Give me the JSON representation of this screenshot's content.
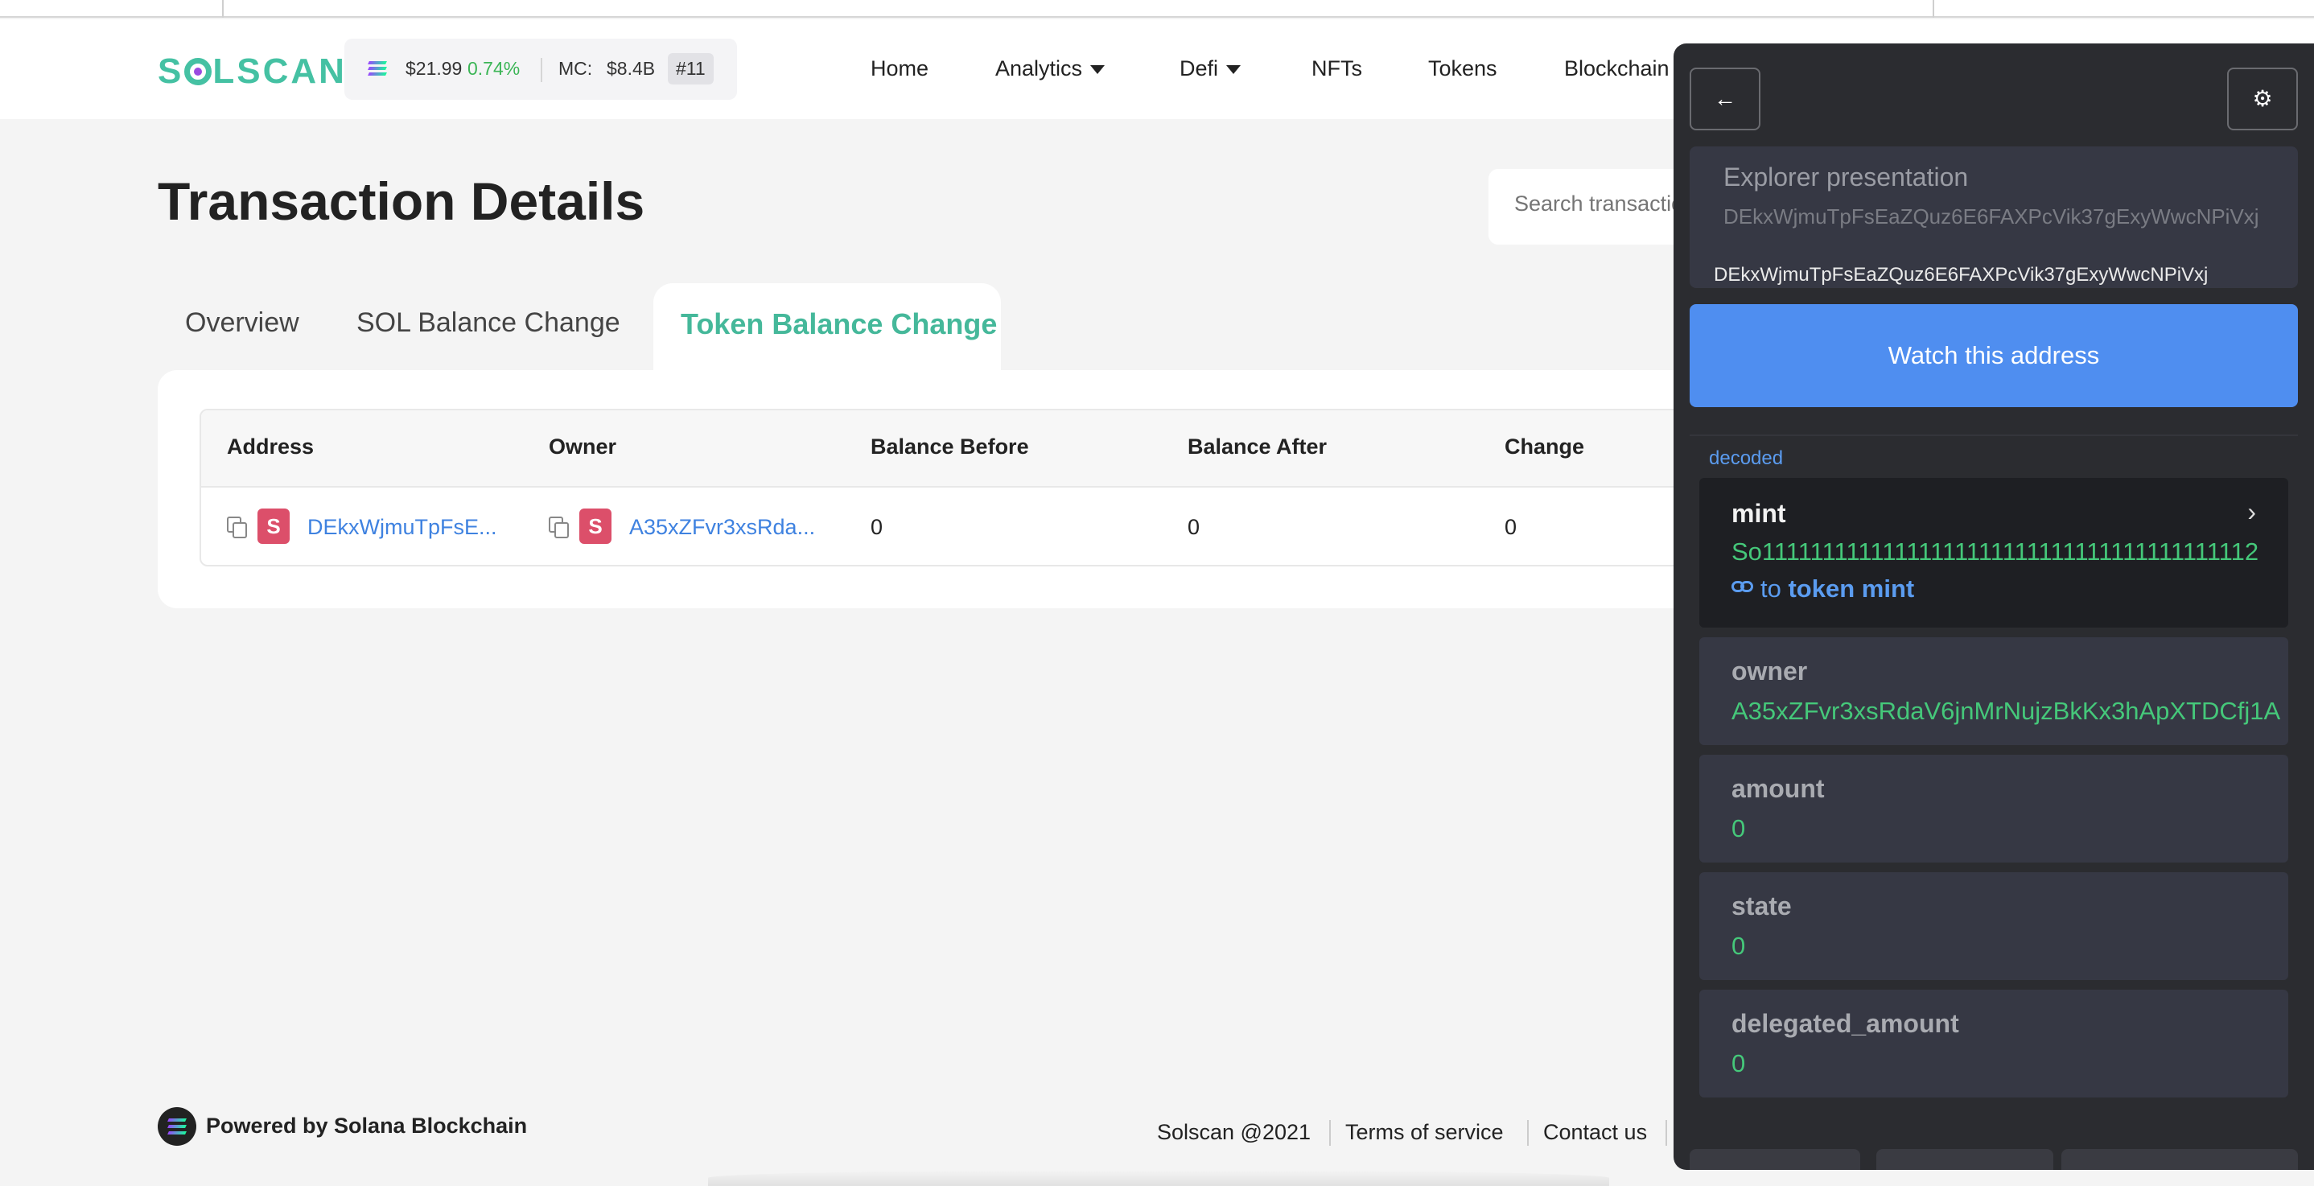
{
  "header": {
    "logo": "SOLSCAN",
    "sol_price": "$21.99",
    "sol_change": "0.74%",
    "mc_label": "MC:",
    "mc_value": "$8.4B",
    "rank": "#11",
    "nav": [
      "Home",
      "Analytics",
      "Defi",
      "NFTs",
      "Tokens",
      "Blockchain"
    ]
  },
  "main": {
    "title": "Transaction Details",
    "search_placeholder": "Search transactions",
    "tabs": [
      "Overview",
      "SOL Balance Change",
      "Token Balance Change"
    ],
    "active_tab": "Token Balance Change",
    "table": {
      "columns": [
        "Address",
        "Owner",
        "Balance Before",
        "Balance After",
        "Change"
      ],
      "rows": [
        {
          "address": "DEkxWjmuTpFsE...",
          "owner": "A35xZFvr3xsRda...",
          "balance_before": "0",
          "balance_after": "0",
          "change": "0"
        }
      ]
    }
  },
  "footer": {
    "powered": "Powered by Solana Blockchain",
    "copyright": "Solscan @2021",
    "terms": "Terms of service",
    "contact": "Contact us"
  },
  "panel": {
    "back_icon": "←",
    "settings_icon": "⚙",
    "explorer_title": "Explorer presentation",
    "explorer_address": "DEkxWjmuTpFsEaZQuz6E6FAXPcVik37gExyWwcNPiVxj",
    "address": "DEkxWjmuTpFsEaZQuz6E6FAXPcVik37gExyWwcNPiVxj",
    "watch_button": "Watch this address",
    "decoded_label": "decoded",
    "fields": {
      "mint_key": "mint",
      "mint_value": "So11111111111111111111111111111111111111112",
      "mint_link_prefix": "to",
      "mint_link": "token mint",
      "owner_key": "owner",
      "owner_value": "A35xZFvr3xsRdaV6jnMrNujzBkKx3hApXTDCfj1A",
      "amount_key": "amount",
      "amount_value": "0",
      "state_key": "state",
      "state_value": "0",
      "delegated_key": "delegated_amount",
      "delegated_value": "0"
    }
  },
  "colors": {
    "brand": "#45c1a3",
    "link": "#3f82e0",
    "panel_bg": "#2b2c30",
    "watch_button": "#4f8ef0",
    "value_green": "#45c87a"
  }
}
